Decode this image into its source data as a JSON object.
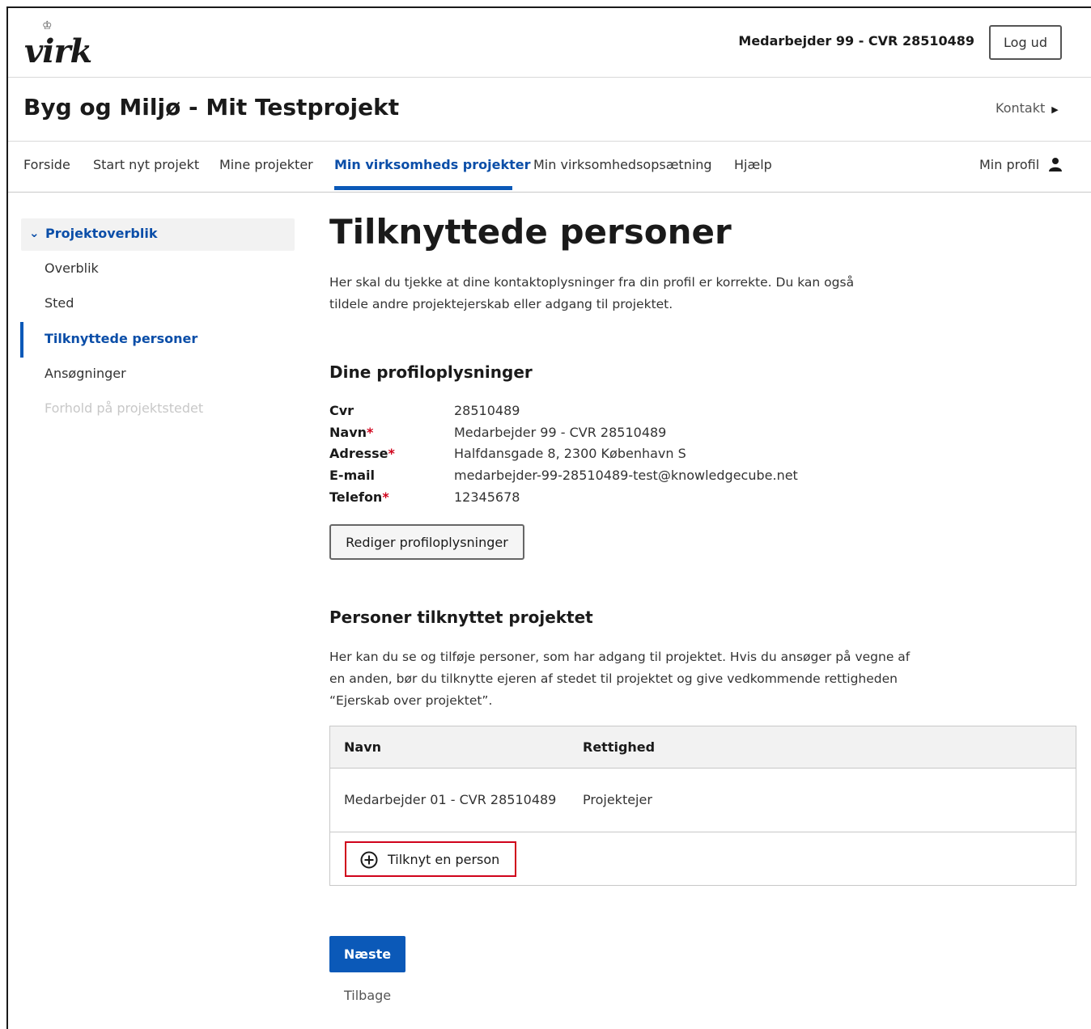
{
  "header": {
    "logo_text": "virk",
    "user_label": "Medarbejder 99 - CVR 28510489",
    "logout_label": "Log ud"
  },
  "titlebar": {
    "title": "Byg og Miljø - Mit Testprojekt",
    "contact_label": "Kontakt"
  },
  "nav": {
    "items": [
      {
        "label": "Forside"
      },
      {
        "label": "Start nyt projekt"
      },
      {
        "label": "Mine projekter"
      },
      {
        "label": "Min virksomheds projekter",
        "active": true
      },
      {
        "label": "Min virksomhedsopsætning"
      },
      {
        "label": "Hjælp"
      }
    ],
    "profile_label": "Min profil"
  },
  "sidebar": {
    "heading": "Projektoverblik",
    "items": [
      {
        "label": "Overblik"
      },
      {
        "label": "Sted"
      },
      {
        "label": "Tilknyttede personer",
        "active": true
      },
      {
        "label": "Ansøgninger"
      },
      {
        "label": "Forhold på projektstedet",
        "disabled": true
      }
    ]
  },
  "main": {
    "title": "Tilknyttede personer",
    "intro": "Her skal du tjekke at dine kontaktoplysninger fra din profil er korrekte. Du kan også tildele andre projektejerskab eller adgang til projektet.",
    "profile_section": {
      "heading": "Dine profiloplysninger",
      "fields": [
        {
          "key": "Cvr",
          "required": false,
          "value": "28510489"
        },
        {
          "key": "Navn",
          "required": true,
          "value": "Medarbejder 99 - CVR 28510489"
        },
        {
          "key": "Adresse",
          "required": true,
          "value": "Halfdansgade 8, 2300 København S"
        },
        {
          "key": "E-mail",
          "required": false,
          "value": "medarbejder-99-28510489-test@knowledgecube.net"
        },
        {
          "key": "Telefon",
          "required": true,
          "value": "12345678"
        }
      ],
      "required_mark": "*",
      "edit_button": "Rediger profiloplysninger"
    },
    "persons_section": {
      "heading": "Personer tilknyttet projektet",
      "intro": "Her kan du se og tilføje personer, som har adgang til projektet. Hvis du ansøger på vegne af en anden, bør du tilknytte ejeren af stedet til projektet og give vedkommende rettigheden “Ejerskab over projektet”.",
      "columns": [
        "Navn",
        "Rettighed"
      ],
      "rows": [
        {
          "name": "Medarbejder 01 - CVR 28510489",
          "right": "Projektejer"
        }
      ],
      "add_button": "Tilknyt en person"
    },
    "next_button": "Næste",
    "back_link": "Tilbage"
  },
  "colors": {
    "accent": "#0b59b8",
    "link_active": "#0b4ea8",
    "required": "#d0021b",
    "highlight_border": "#d0021b"
  }
}
